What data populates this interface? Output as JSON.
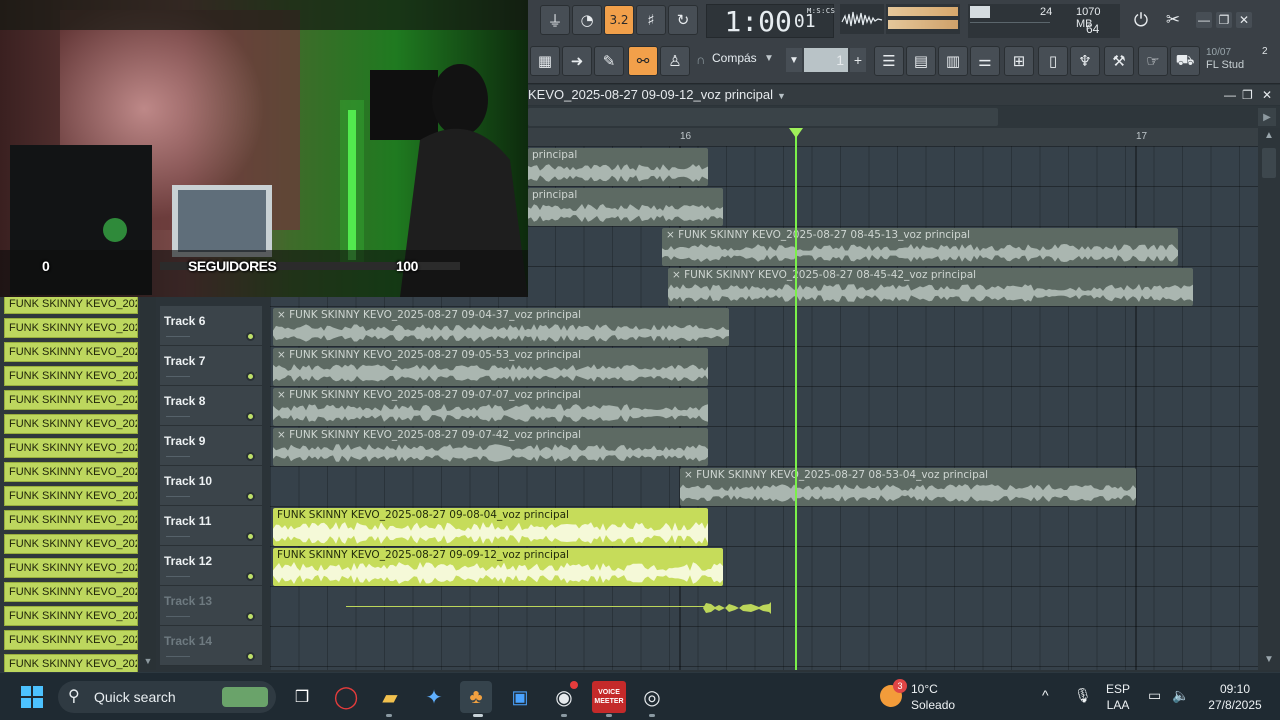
{
  "toolbar": {
    "time": "1:00",
    "time_frac": "01",
    "time_unit": "M:S:CS",
    "cpu_value": "24",
    "memory": "1070 MB",
    "polyphony": "64",
    "pattern_label": "3.2",
    "snap_label": "Compás",
    "step_value": "1",
    "news_date": "10/07",
    "news_title": "FL Stud",
    "news_badge": "2",
    "icons": [
      "metronome-icon",
      "wait-icon",
      "record-icon",
      "song-icon",
      "loop-icon",
      "piano-roll-icon",
      "arrow-icon",
      "pen-icon",
      "link-icon",
      "stamp-icon",
      "mixer-icon",
      "channel-rack-icon",
      "browser-icon",
      "plugin-icon",
      "shop-icon"
    ]
  },
  "playlist": {
    "title": "KEVO_2025-08-27 09-09-12_voz principal",
    "bar_numbers": [
      "16",
      "17"
    ],
    "tracks": [
      {
        "name": "Track 6",
        "dim": false
      },
      {
        "name": "Track 7",
        "dim": false
      },
      {
        "name": "Track 8",
        "dim": false
      },
      {
        "name": "Track 9",
        "dim": false
      },
      {
        "name": "Track 10",
        "dim": false
      },
      {
        "name": "Track 11",
        "dim": false
      },
      {
        "name": "Track 12",
        "dim": false
      },
      {
        "name": "Track 13",
        "dim": true
      },
      {
        "name": "Track 14",
        "dim": true
      }
    ],
    "clips": [
      {
        "label": "principal",
        "selected": false
      },
      {
        "label": "principal",
        "selected": false
      },
      {
        "label": "× FUNK SKINNY KEVO_2025-08-27 08-45-13_voz principal",
        "selected": false
      },
      {
        "label": "× FUNK SKINNY KEVO_2025-08-27 08-45-42_voz principal",
        "selected": false
      },
      {
        "label": "× FUNK SKINNY KEVO_2025-08-27 09-04-37_voz principal",
        "selected": false
      },
      {
        "label": "× FUNK SKINNY KEVO_2025-08-27 09-05-53_voz principal",
        "selected": false
      },
      {
        "label": "× FUNK SKINNY KEVO_2025-08-27 09-07-07_voz principal",
        "selected": false
      },
      {
        "label": "× FUNK SKINNY KEVO_2025-08-27 09-07-42_voz principal",
        "selected": false
      },
      {
        "label": "× FUNK SKINNY KEVO_2025-08-27 08-53-04_voz principal",
        "selected": false
      },
      {
        "label": "FUNK SKINNY KEVO_2025-08-27 09-08-04_voz principal",
        "selected": true
      },
      {
        "label": "FUNK SKINNY KEVO_2025-08-27 09-09-12_voz principal",
        "selected": true
      }
    ],
    "patterns": [
      "FUNK SKINNY KEVO_2025...",
      "FUNK SKINNY KEVO_2025...",
      "FUNK SKINNY KEVO_2025...",
      "FUNK SKINNY KEVO_2025...",
      "FUNK SKINNY KEVO_2025...",
      "FUNK SKINNY KEVO_2025...",
      "FUNK SKINNY KEVO_2025...",
      "FUNK SKINNY KEVO_2025...",
      "FUNK SKINNY KEVO_2025...",
      "FUNK SKINNY KEVO_2025...",
      "FUNK SKINNY KEVO_2025...",
      "FUNK SKINNY KEVO_2025...",
      "FUNK SKINNY KEVO_2025...",
      "FUNK SKINNY KEVO_2025...",
      "FUNK SKINNY KEVO_2025...",
      "FUNK SKINNY KEVO_2025..."
    ]
  },
  "webcam": {
    "left_count": "0",
    "label": "SEGUIDORES",
    "right_count": "100"
  },
  "taskbar": {
    "search_placeholder": "Quick search",
    "weather_temp": "10°C",
    "weather_desc": "Soleado",
    "weather_badge": "3",
    "lang_top": "ESP",
    "lang_bottom": "LAA",
    "time": "09:10",
    "date": "27/8/2025",
    "voice_label_top": "VOICE",
    "voice_label_bottom": "MEETER"
  },
  "colors": {
    "accent": "#f2a04a",
    "playhead": "#7bf04a",
    "clip_selected": "#c6dc5a",
    "clip_unselected": "#5d6a63"
  }
}
